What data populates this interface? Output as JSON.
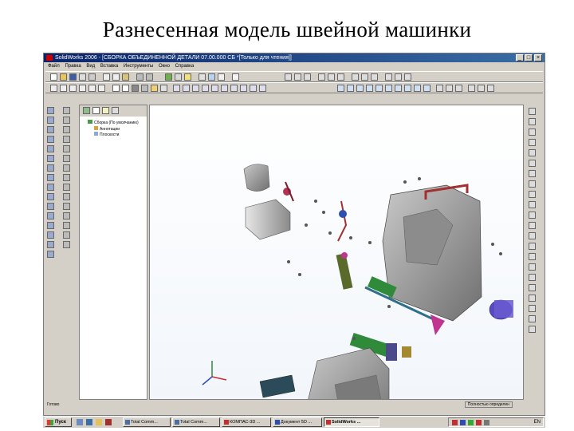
{
  "slide": {
    "title": "Разнесенная модель швейной машинки"
  },
  "window": {
    "title": "SolidWorks 2006 - [СБОРКА ОБЪЕДИНЕННОЙ ДЕТАЛИ 07.00.000 СБ *[Только для чтения]]",
    "buttons": [
      "_",
      "□",
      "×"
    ],
    "menu": [
      "Файл",
      "Правка",
      "Вид",
      "Вставка",
      "Инструменты",
      "Окно",
      "Справка"
    ]
  },
  "feature_tree": {
    "root": "Сборка (По умолчанию)",
    "items": [
      "Аннотации",
      "Плоскости"
    ]
  },
  "status": {
    "left": "Готово",
    "right": "Полностью определен"
  },
  "taskbar": {
    "start": "Пуск",
    "tasks": [
      "Total Comm...",
      "Total Comm...",
      "КОМПАС-3D ...",
      "Документ 5D ...",
      "SolidWorks ..."
    ],
    "clock": "EN"
  },
  "colors": {
    "title_bar": "#0a246a",
    "chrome": "#d4d0c8",
    "part_gray": "#9a9a9a",
    "part_green": "#2f8a3a",
    "part_purple": "#5a4ac0",
    "part_magenta": "#c0338f",
    "part_red": "#a33030"
  }
}
